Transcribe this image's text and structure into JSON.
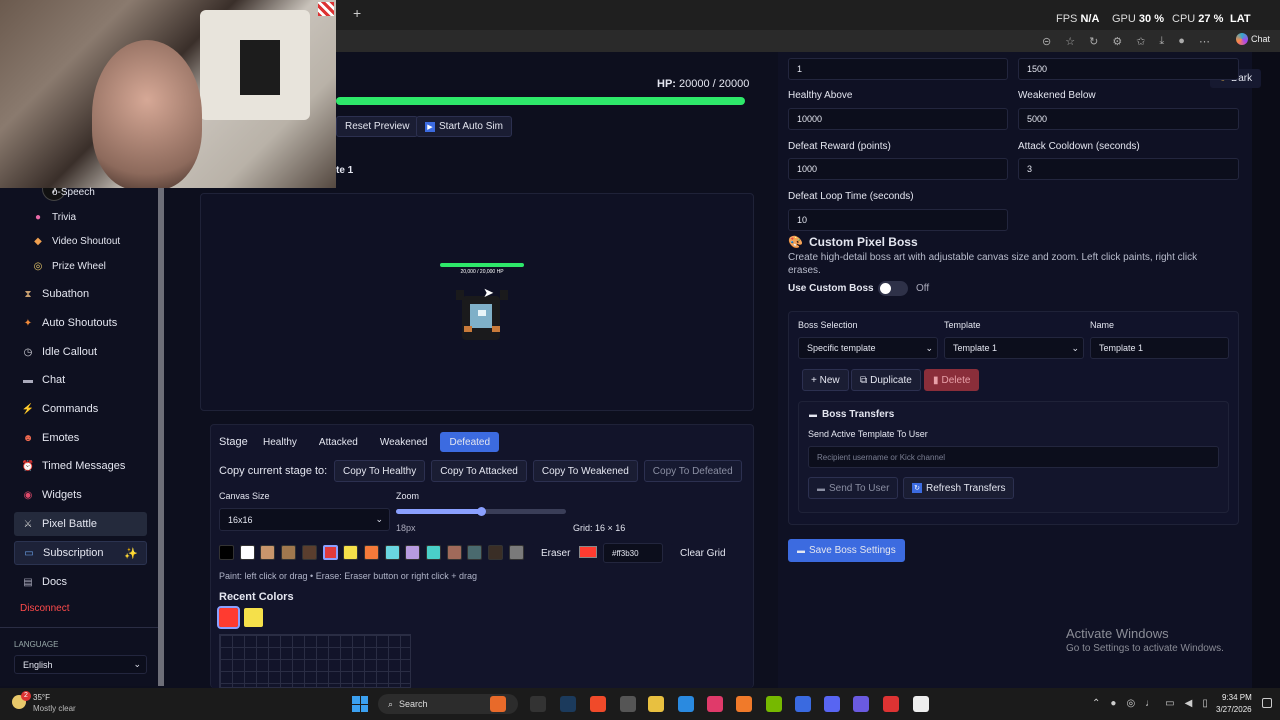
{
  "browser": {
    "fps": "N/A",
    "gpu": "30 %",
    "cpu": "27 %",
    "extra": "LAT",
    "chat_btn": "Chat",
    "new_tab": "+"
  },
  "preview": {
    "hp_label": "HP:",
    "hp_value": "20000 / 20000",
    "hp_fraction": 1.0,
    "reset_btn": "Reset Preview",
    "auto_btn": "Start Auto Sim",
    "template_title": "te 1",
    "boss_hp_text": "20,000 / 20,000 HP"
  },
  "sidebar": {
    "items": [
      {
        "label": "o-Speech",
        "icon": "tts-icon",
        "sub": true
      },
      {
        "label": "Trivia",
        "icon": "dot-icon",
        "sub": true
      },
      {
        "label": "Video Shoutout",
        "icon": "diamond-icon",
        "sub": true
      },
      {
        "label": "Prize Wheel",
        "icon": "wheel-icon",
        "sub": true
      },
      {
        "label": "Subathon",
        "icon": "hourglass-icon"
      },
      {
        "label": "Auto Shoutouts",
        "icon": "shoutout-icon"
      },
      {
        "label": "Idle Callout",
        "icon": "clock-icon"
      },
      {
        "label": "Chat",
        "icon": "chat-icon"
      },
      {
        "label": "Commands",
        "icon": "lightning-icon"
      },
      {
        "label": "Emotes",
        "icon": "emote-icon"
      },
      {
        "label": "Timed Messages",
        "icon": "alarm-icon"
      },
      {
        "label": "Widgets",
        "icon": "widget-icon"
      },
      {
        "label": "Pixel Battle",
        "icon": "swords-icon"
      },
      {
        "label": "Subscription",
        "icon": "card-icon"
      },
      {
        "label": "Docs",
        "icon": "book-icon"
      }
    ],
    "disconnect": "Disconnect",
    "language_label": "LANGUAGE",
    "language_value": "English"
  },
  "editor": {
    "stage_label": "Stage",
    "stages": [
      "Healthy",
      "Attacked",
      "Weakened",
      "Defeated"
    ],
    "active_stage": "Defeated",
    "copy_label": "Copy current stage to:",
    "copy_buttons": [
      "Copy To Healthy",
      "Copy To Attacked",
      "Copy To Weakened",
      "Copy To Defeated"
    ],
    "canvas_label": "Canvas Size",
    "canvas_value": "16x16",
    "zoom_label": "Zoom",
    "zoom_value": "18px",
    "zoom_fraction": 0.5,
    "grid_label": "Grid: 16 × 16",
    "palette": [
      "#000000",
      "#ffffff",
      "#c8966c",
      "#a0784e",
      "#5a3e2e",
      "#e03a3a",
      "#f5e04a",
      "#f47a3a",
      "#6ad6e0",
      "#b89ce0",
      "#4ad0c8",
      "#a06a5a",
      "#4a6a6e",
      "#3a2e26",
      "#7a7a7a"
    ],
    "eraser": "Eraser",
    "current_color": "#ff3b30",
    "current_color_hex": "#ff3b30",
    "clear_grid": "Clear Grid",
    "hint": "Paint: left click or drag • Erase: Eraser button or right click + drag",
    "recent_label": "Recent Colors",
    "recent": [
      "#ff3b30",
      "#f5e04a"
    ]
  },
  "settings": {
    "row0": [
      "1",
      "1500"
    ],
    "healthy_above_label": "Healthy Above",
    "healthy_above": "10000",
    "weakened_below_label": "Weakened Below",
    "weakened_below": "5000",
    "defeat_reward_label": "Defeat Reward (points)",
    "defeat_reward": "1000",
    "attack_cooldown_label": "Attack Cooldown (seconds)",
    "attack_cooldown": "3",
    "defeat_loop_label": "Defeat Loop Time (seconds)",
    "defeat_loop": "10",
    "dark_btn": "Dark"
  },
  "custom_boss": {
    "title": "Custom Pixel Boss",
    "description": "Create high-detail boss art with adjustable canvas size and zoom. Left click paints, right click erases.",
    "use_label": "Use Custom Boss",
    "use_state": "Off",
    "boss_selection_label": "Boss Selection",
    "boss_selection": "Specific template",
    "template_label": "Template",
    "template": "Template 1",
    "name_label": "Name",
    "name": "Template 1",
    "new_btn": "+ New",
    "duplicate_btn": "Duplicate",
    "delete_btn": "Delete",
    "transfers_title": "Boss Transfers",
    "send_label": "Send Active Template To User",
    "recipient_placeholder": "Recipient username or Kick channel",
    "send_btn": "Send To User",
    "refresh_btn": "Refresh Transfers",
    "save_btn": "Save Boss Settings"
  },
  "watermark": {
    "line1": "Activate Windows",
    "line2": "Go to Settings to activate Windows."
  },
  "taskbar": {
    "weather_temp": "35°F",
    "weather_desc": "Mostly clear",
    "search": "Search",
    "time": "9:34 PM",
    "date": "3/27/2026",
    "badge": "2"
  }
}
